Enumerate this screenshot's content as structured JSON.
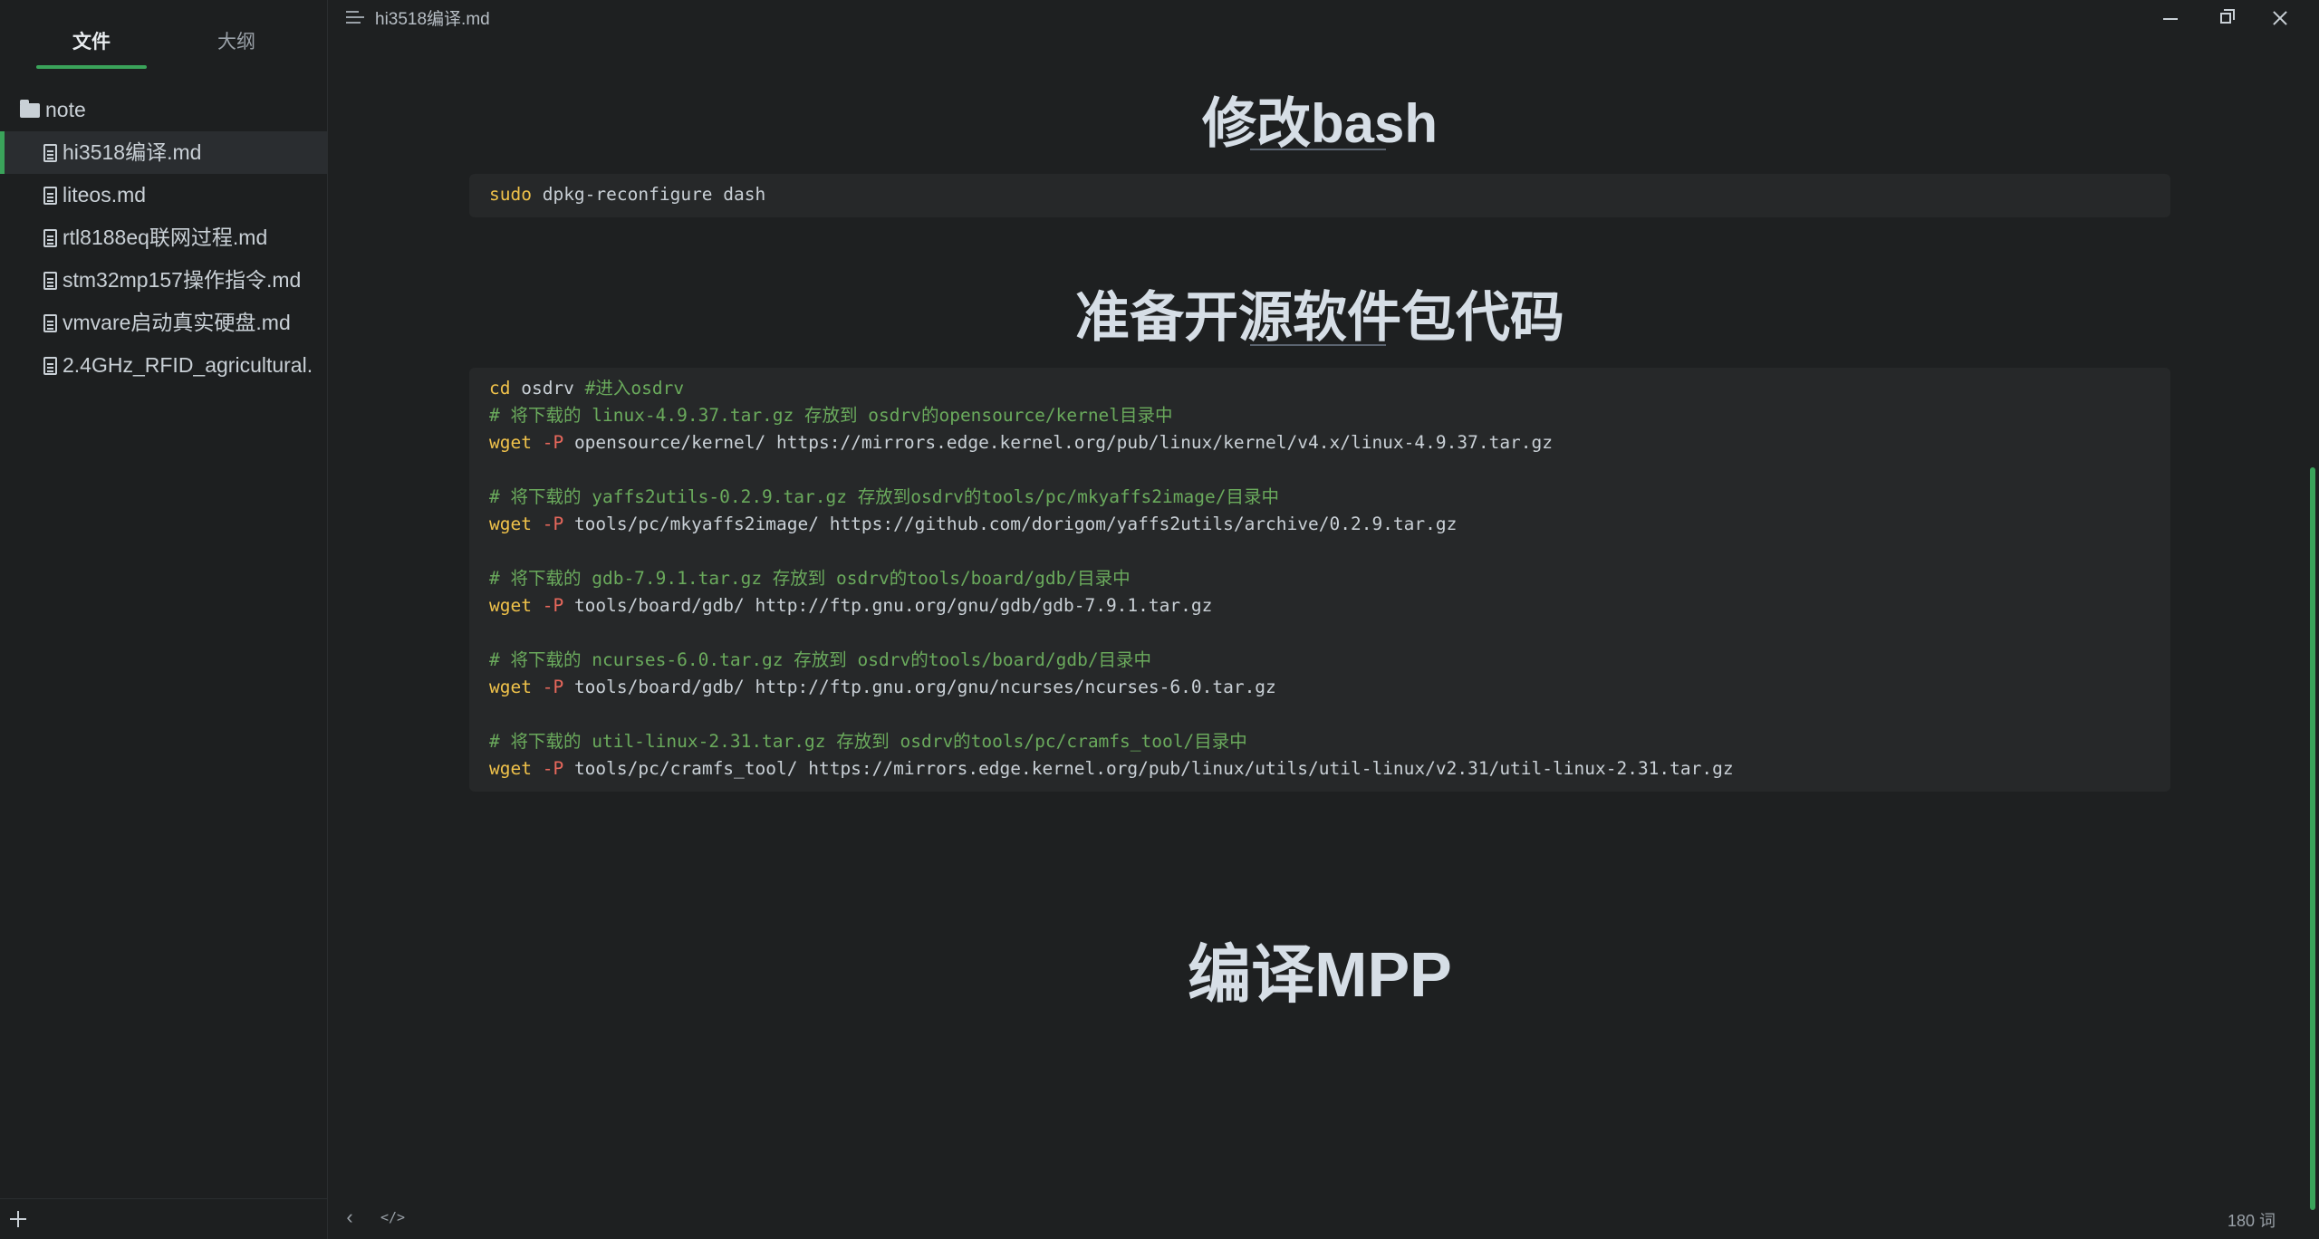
{
  "sidebar": {
    "tabs": [
      {
        "label": "文件"
      },
      {
        "label": "大纲"
      }
    ],
    "folder": {
      "name": "note"
    },
    "files": [
      {
        "name": "hi3518编译.md"
      },
      {
        "name": "liteos.md"
      },
      {
        "name": "rtl8188eq联网过程.md"
      },
      {
        "name": "stm32mp157操作指令.md"
      },
      {
        "name": "vmvare启动真实硬盘.md"
      },
      {
        "name": "2.4GHz_RFID_agricultural."
      }
    ]
  },
  "titlebar": {
    "doc_title": "hi3518编译.md"
  },
  "document": {
    "heading1": "修改bash",
    "code1": {
      "lines": [
        {
          "kw": "sudo",
          "rest": " dpkg-reconfigure dash"
        }
      ]
    },
    "heading2": "准备开源软件包代码",
    "code2": {
      "lines": [
        {
          "kw": "cd",
          "rest": " osdrv ",
          "comment": "#进入osdrv"
        },
        {
          "comment": "# 将下载的 linux-4.9.37.tar.gz 存放到 osdrv的opensource/kernel目录中"
        },
        {
          "kw": "wget",
          "flag": " -P",
          "rest": " opensource/kernel/ https://mirrors.edge.kernel.org/pub/linux/kernel/v4.x/linux-4.9.37.tar.gz"
        },
        {},
        {
          "comment": "# 将下载的 yaffs2utils-0.2.9.tar.gz 存放到osdrv的tools/pc/mkyaffs2image/目录中"
        },
        {
          "kw": "wget",
          "flag": " -P",
          "rest": " tools/pc/mkyaffs2image/ https://github.com/dorigom/yaffs2utils/archive/0.2.9.tar.gz"
        },
        {},
        {
          "comment": "# 将下载的 gdb-7.9.1.tar.gz 存放到 osdrv的tools/board/gdb/目录中"
        },
        {
          "kw": "wget",
          "flag": " -P",
          "rest": " tools/board/gdb/ http://ftp.gnu.org/gnu/gdb/gdb-7.9.1.tar.gz"
        },
        {},
        {
          "comment": "# 将下载的 ncurses-6.0.tar.gz 存放到 osdrv的tools/board/gdb/目录中"
        },
        {
          "kw": "wget",
          "flag": " -P",
          "rest": " tools/board/gdb/ http://ftp.gnu.org/gnu/ncurses/ncurses-6.0.tar.gz"
        },
        {},
        {
          "comment": "# 将下载的 util-linux-2.31.tar.gz 存放到 osdrv的tools/pc/cramfs_tool/目录中"
        },
        {
          "kw": "wget",
          "flag": " -P",
          "rest": " tools/pc/cramfs_tool/ https://mirrors.edge.kernel.org/pub/linux/utils/util-linux/v2.31/util-linux-2.31.tar.gz"
        }
      ]
    },
    "heading3": "编译MPP"
  },
  "footer": {
    "word_count": "180 词"
  },
  "colors": {
    "accent": "#3aa35a",
    "background": "#1e2021",
    "code_keyword": "#f0c24a",
    "code_flag": "#e8685c",
    "code_comment": "#6aaa5c"
  }
}
